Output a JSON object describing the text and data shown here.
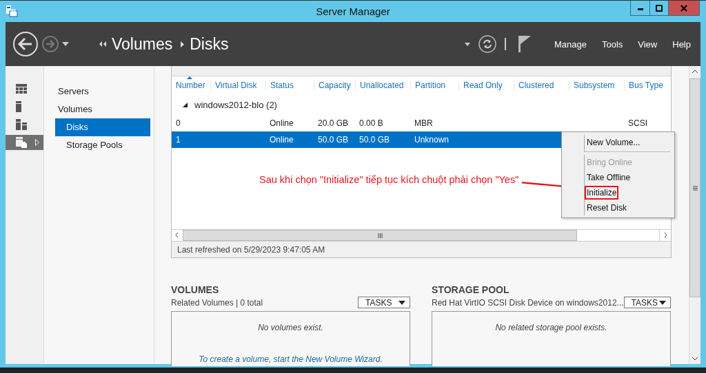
{
  "window": {
    "title": "Server Manager"
  },
  "breadcrumb": [
    "Volumes",
    "Disks"
  ],
  "menu": [
    "Manage",
    "Tools",
    "View",
    "Help"
  ],
  "rail": [
    {
      "selected": false
    },
    {
      "selected": false
    },
    {
      "selected": false
    },
    {
      "selected": true
    }
  ],
  "nav": [
    {
      "label": "Servers",
      "selected": false
    },
    {
      "label": "Volumes",
      "selected": false,
      "children": [
        {
          "label": "Disks",
          "selected": true
        },
        {
          "label": "Storage Pools",
          "selected": false
        }
      ]
    }
  ],
  "table": {
    "columns": [
      "Number",
      "Virtual Disk",
      "Status",
      "Capacity",
      "Unallocated",
      "Partition",
      "Read Only",
      "Clustered",
      "Subsystem",
      "Bus Type"
    ],
    "group": "windows2012-blo (2)",
    "rows": [
      {
        "selected": false,
        "cells": [
          "0",
          "",
          "Online",
          "20.0 GB",
          "0.00 B",
          "MBR",
          "",
          "",
          "",
          "SCSI"
        ]
      },
      {
        "selected": true,
        "cells": [
          "1",
          "",
          "Online",
          "50.0 GB",
          "50.0 GB",
          "Unknown",
          "",
          "",
          "",
          ""
        ]
      }
    ],
    "status": "Last refreshed on 5/29/2023 9:47:05 AM"
  },
  "context_menu": [
    {
      "label": "New Volume...",
      "disabled": false,
      "highlighted": false,
      "separator_after": true
    },
    {
      "label": "Bring Online",
      "disabled": true,
      "highlighted": false,
      "separator_after": false
    },
    {
      "label": "Take Offline",
      "disabled": false,
      "highlighted": false,
      "separator_after": false
    },
    {
      "label": "Initialize",
      "disabled": false,
      "highlighted": true,
      "separator_after": false
    },
    {
      "label": "Reset Disk",
      "disabled": false,
      "highlighted": false,
      "separator_after": false
    }
  ],
  "annotation": "Sau khi chọn \"Initialize\" tiếp tục kích chuột phải chọn \"Yes\"",
  "sections": [
    {
      "title": "VOLUMES",
      "subtitle": "Related Volumes | 0 total",
      "tasks": "TASKS",
      "empty": "No volumes exist.",
      "link": "To create a volume, start the New Volume Wizard."
    },
    {
      "title": "STORAGE POOL",
      "subtitle": "Red Hat VirtIO SCSI Disk Device on windows2012...",
      "tasks": "TASKS",
      "empty": "No related storage pool exists."
    }
  ]
}
